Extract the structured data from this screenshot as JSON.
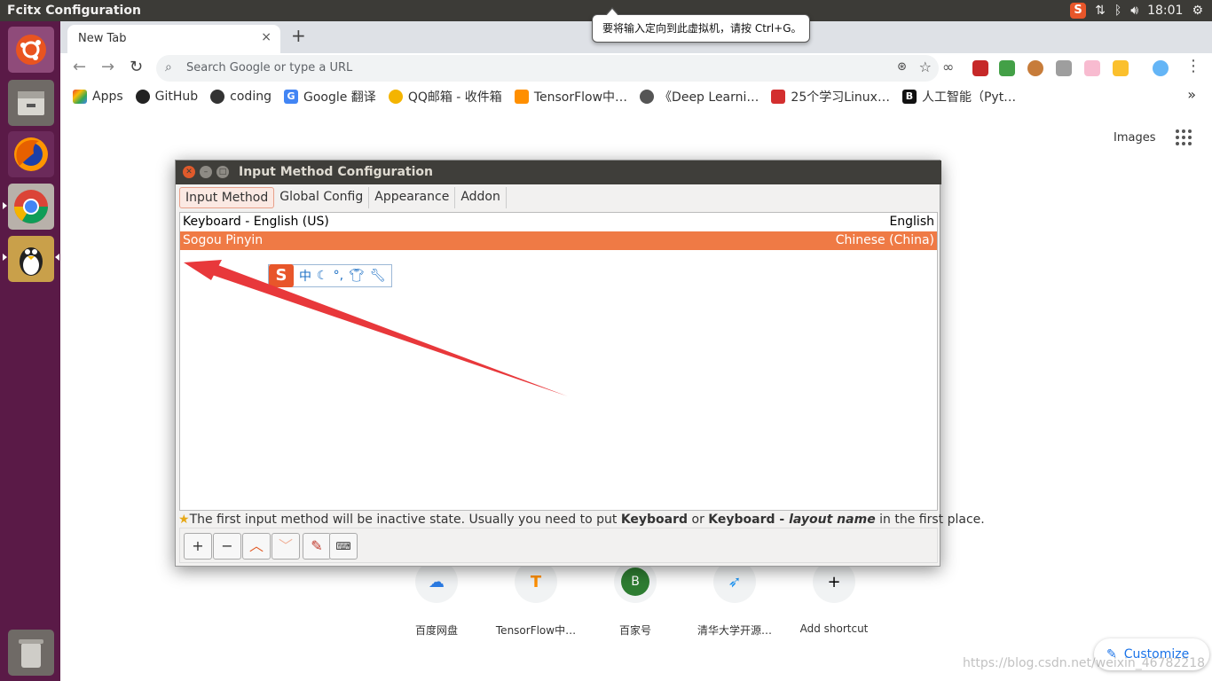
{
  "topbar": {
    "title": "Fcitx Configuration",
    "clock": "18:01"
  },
  "tooltip": {
    "text": "要将输入定向到此虚拟机，请按 Ctrl+G。"
  },
  "browser": {
    "tab_title": "New Tab",
    "tab_close": "×",
    "new_tab": "+",
    "omnibox_placeholder": "Search Google or type a URL",
    "bookmarks": [
      {
        "label": "Apps"
      },
      {
        "label": "GitHub"
      },
      {
        "label": "coding"
      },
      {
        "label": "Google 翻译"
      },
      {
        "label": "QQ邮箱 - 收件箱"
      },
      {
        "label": "TensorFlow中…"
      },
      {
        "label": "《Deep Learni…"
      },
      {
        "label": "25个学习Linux…"
      },
      {
        "label": "人工智能（Pyt…"
      }
    ],
    "bookmarks_more": "»",
    "images_link": "Images",
    "shortcuts": [
      {
        "label": "百度网盘"
      },
      {
        "label": "TensorFlow中…"
      },
      {
        "label": "百家号",
        "letter": "B"
      },
      {
        "label": "清华大学开源…"
      },
      {
        "label": "Add shortcut",
        "symbol": "+"
      }
    ],
    "customize": "Customize",
    "watermark": "https://blog.csdn.net/weixin_46782218"
  },
  "dialog": {
    "title": "Input Method Configuration",
    "tabs": [
      "Input Method",
      "Global Config",
      "Appearance",
      "Addon"
    ],
    "rows": [
      {
        "name": "Keyboard - English (US)",
        "lang": "English",
        "selected": false
      },
      {
        "name": "Sogou Pinyin",
        "lang": "Chinese (China)",
        "selected": true
      }
    ],
    "sogou_bar": {
      "logo": "S",
      "mode": "中"
    },
    "hint": {
      "a": "The first input method will be inactive state. Usually you need to put ",
      "b": "Keyboard",
      "c": " or ",
      "d": "Keyboard - ",
      "e": "layout name",
      "f": " in the first place."
    },
    "toolbar": {
      "add": "+",
      "remove": "−"
    }
  },
  "colors": {
    "accent": "#ef7a45",
    "launcher": "#5a1a47",
    "topbar": "#3c3b37",
    "arrow": "#e8383b"
  }
}
